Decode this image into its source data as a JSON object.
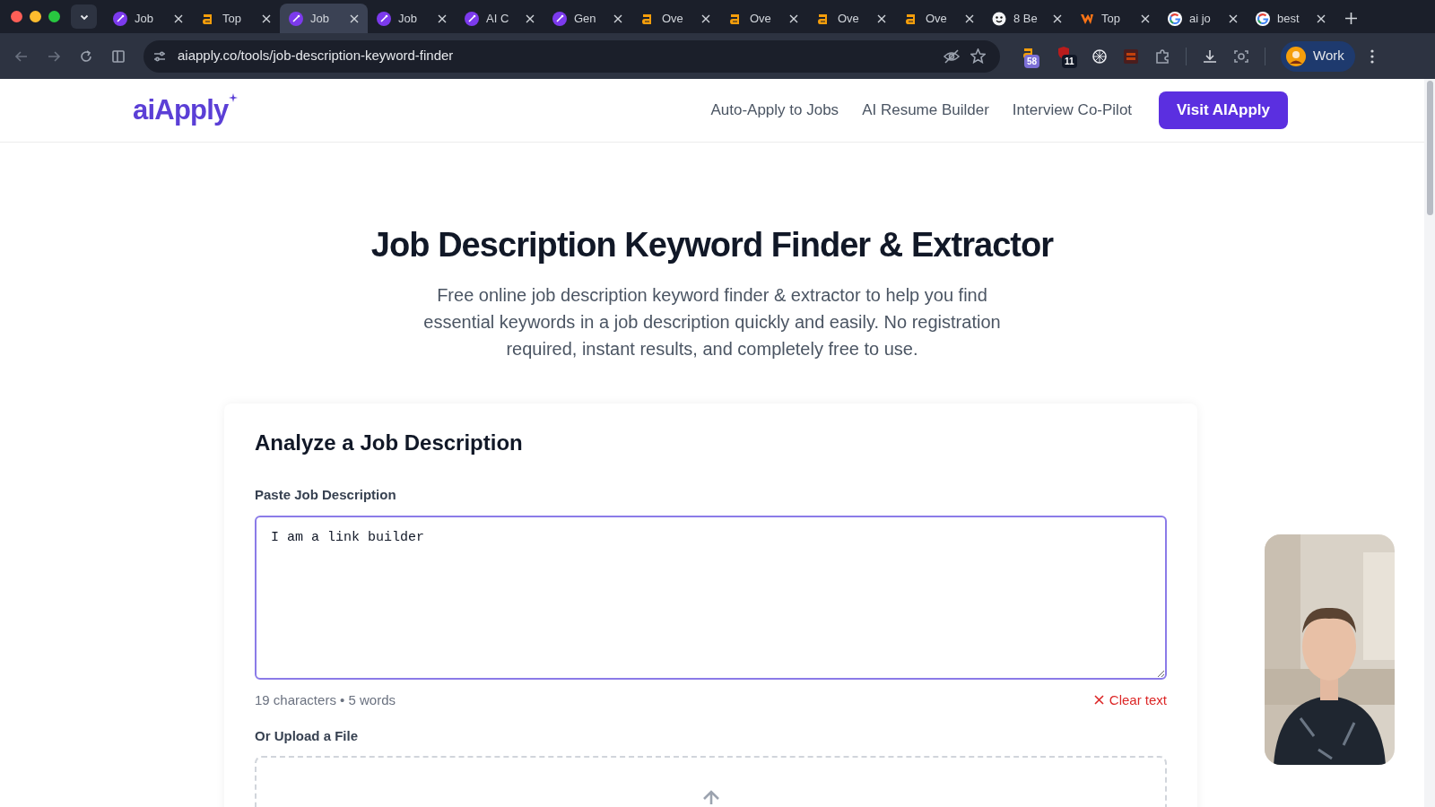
{
  "browser": {
    "tabs": [
      {
        "kind": "pen",
        "title": "Job",
        "selected": false
      },
      {
        "kind": "a",
        "title": "Top",
        "selected": false
      },
      {
        "kind": "pen",
        "title": "Job",
        "selected": true
      },
      {
        "kind": "pen",
        "title": "Job",
        "selected": false
      },
      {
        "kind": "pen",
        "title": "AI C",
        "selected": false
      },
      {
        "kind": "pen",
        "title": "Gen",
        "selected": false
      },
      {
        "kind": "a",
        "title": "Ove",
        "selected": false
      },
      {
        "kind": "a",
        "title": "Ove",
        "selected": false
      },
      {
        "kind": "a",
        "title": "Ove",
        "selected": false
      },
      {
        "kind": "a",
        "title": "Ove",
        "selected": false
      },
      {
        "kind": "face",
        "title": "8 Be",
        "selected": false
      },
      {
        "kind": "v",
        "title": "Top",
        "selected": false
      },
      {
        "kind": "google",
        "title": "ai jo",
        "selected": false
      },
      {
        "kind": "google",
        "title": "best",
        "selected": false
      }
    ],
    "url": "aiapply.co/tools/job-description-keyword-finder",
    "extension_badges": [
      "58",
      "11"
    ],
    "profile": "Work"
  },
  "site": {
    "logo": "aiApply",
    "nav": [
      "Auto-Apply to Jobs",
      "AI Resume Builder",
      "Interview Co-Pilot"
    ],
    "cta": "Visit AIApply"
  },
  "hero": {
    "title": "Job Description Keyword Finder & Extractor",
    "description": "Free online job description keyword finder & extractor to help you find essential keywords in a job description quickly and easily. No registration required, instant results, and completely free to use."
  },
  "analyzer": {
    "heading": "Analyze a Job Description",
    "field_label": "Paste Job Description",
    "value": "I am a link builder",
    "counts": "19 characters • 5 words",
    "clear": "Clear text",
    "upload_label": "Or Upload a File"
  }
}
